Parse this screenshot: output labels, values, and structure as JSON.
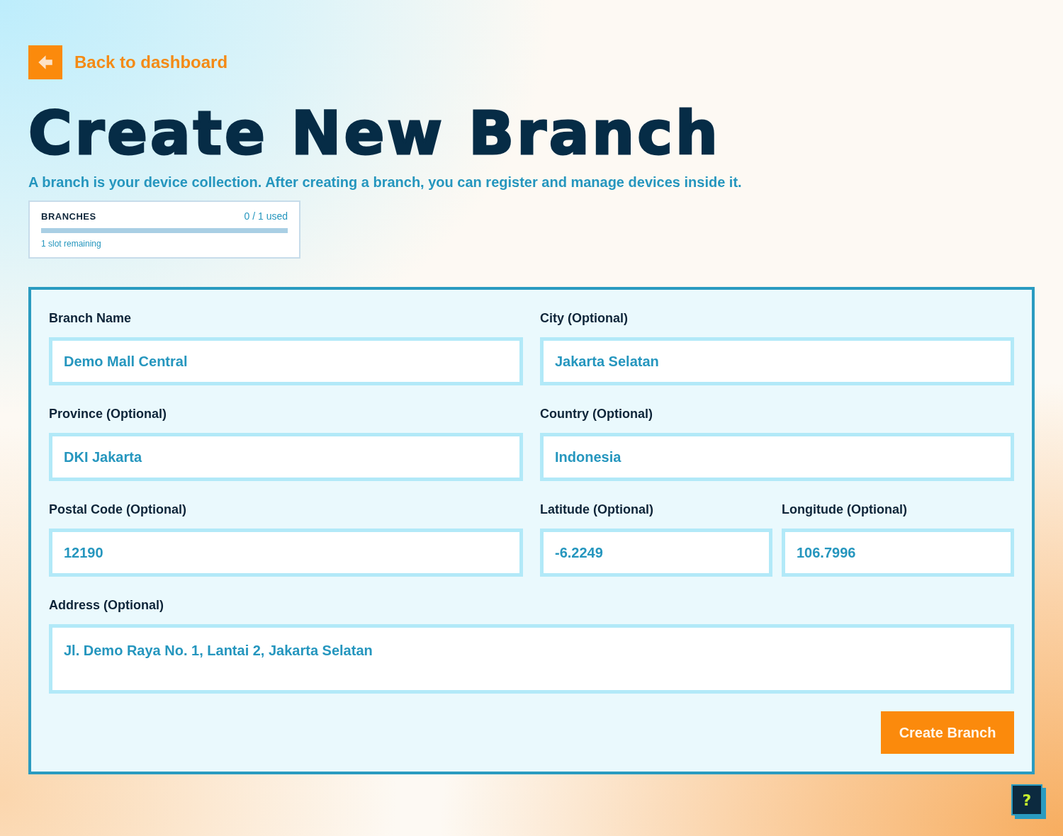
{
  "back_link": {
    "label": "Back to dashboard"
  },
  "title": "Create New Branch",
  "subtitle": "A branch is your device collection. After creating a branch, you can register and manage devices inside it.",
  "usage_card": {
    "label": "BRANCHES",
    "usage": "0 / 1 used",
    "level": 0,
    "note": "1 slot remaining"
  },
  "form": {
    "rows": [
      [
        {
          "label": "Branch Name",
          "value": "Demo Mall Central",
          "kind": "text"
        },
        {
          "label": "City (Optional)",
          "value": "Jakarta Selatan",
          "kind": "text"
        }
      ],
      [
        {
          "label": "Province (Optional)",
          "value": "DKI Jakarta",
          "kind": "text"
        },
        {
          "label": "Country (Optional)",
          "value": "Indonesia",
          "kind": "text"
        }
      ],
      [
        {
          "label": "Postal Code (Optional)",
          "value": "12190",
          "kind": "text"
        },
        {
          "label": "Latitude (Optional)",
          "value": "-6.2249",
          "kind": "text"
        },
        {
          "label": "Longitude (Optional)",
          "value": "106.7996",
          "kind": "text"
        }
      ],
      [
        {
          "label": "Address (Optional)",
          "value": "Jl. Demo Raya No. 1, Lantai 2, Jakarta Selatan",
          "kind": "multiline"
        }
      ]
    ],
    "submit_button": "Create Branch"
  },
  "help_button": {
    "label": "?"
  }
}
